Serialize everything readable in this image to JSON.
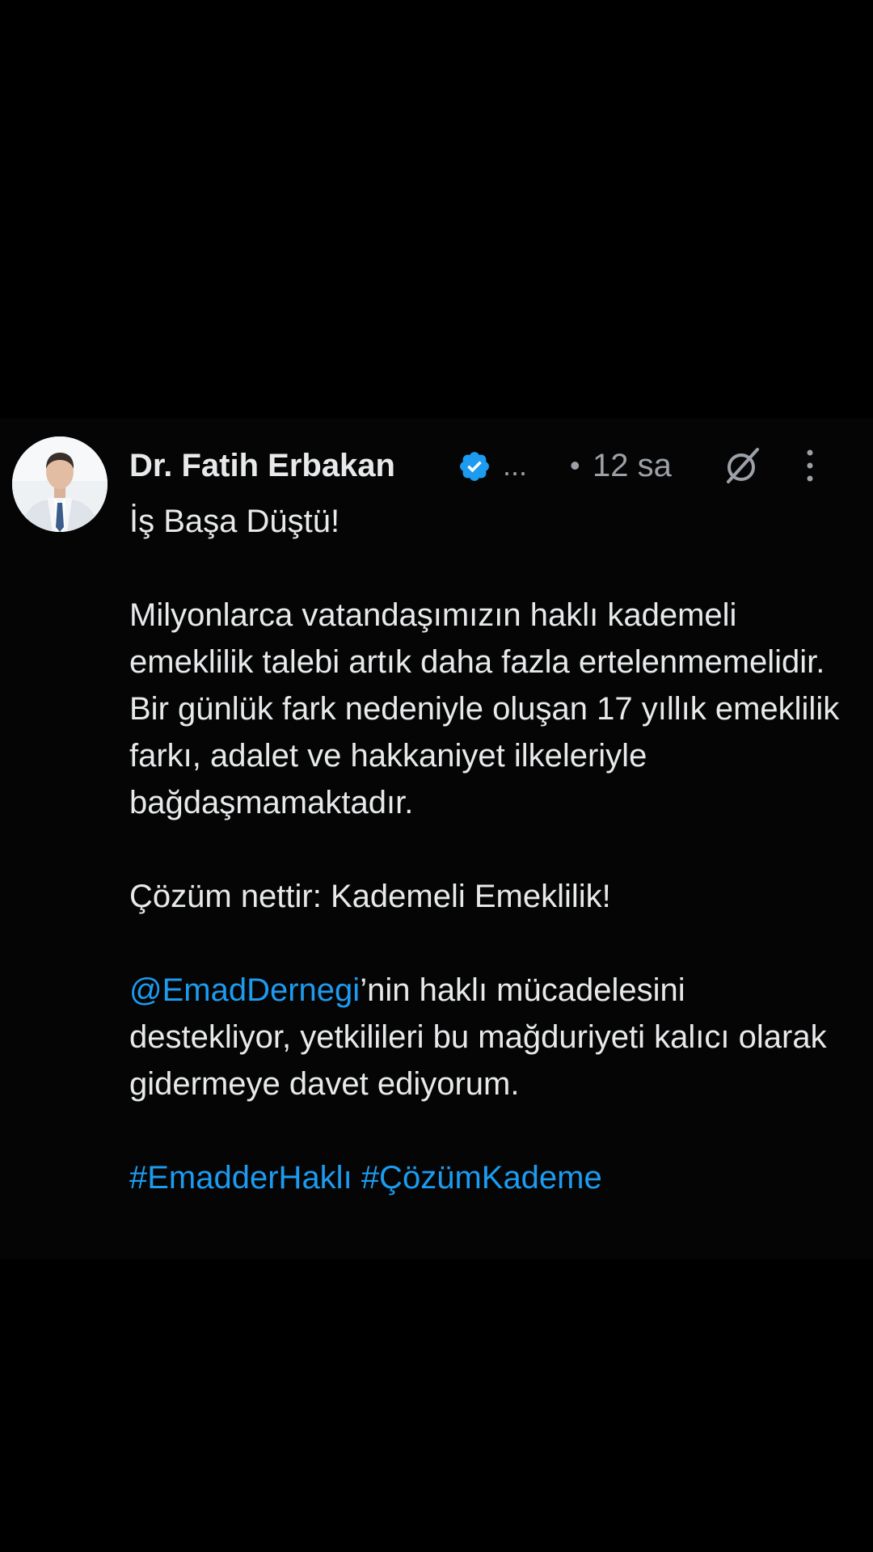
{
  "tweet": {
    "author": {
      "display_name": "Dr. Fatih Erbakan",
      "verified_icon": "verified-badge-icon",
      "handle_truncated": "...",
      "avatar": "profile-photo"
    },
    "time_separator": "•",
    "timestamp": "12 sa",
    "grok_icon": "grok-icon",
    "more_icon": "more-vertical-icon",
    "body": {
      "title": "İş Başa Düştü!",
      "paragraph1": "Milyonlarca vatandaşımızın haklı kademeli emeklilik talebi artık daha fazla ertelenmemelidir. Bir günlük fark nedeniyle oluşan 17 yıllık emeklilik farkı, adalet ve hakkaniyet ilkeleriyle bağdaşmamaktadır.",
      "paragraph2": "Çözüm nettir: Kademeli Emeklilik!",
      "mention": "@EmadDernegi",
      "paragraph3_rest": "’nin haklı mücadelesini destekliyor, yetkilileri bu mağduriyeti kalıcı olarak gidermeye davet ediyorum.",
      "hashtag1": "#EmadderHaklı",
      "hashtag2": "#ÇözümKademe"
    },
    "colors": {
      "background": "#000000",
      "text": "#e7e9ea",
      "secondary": "#9ba1a6",
      "link": "#1d9bf0",
      "verified": "#1d9bf0"
    }
  }
}
